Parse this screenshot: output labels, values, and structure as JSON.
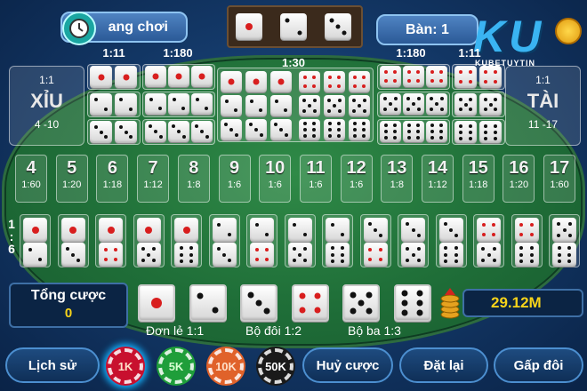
{
  "header": {
    "game_mode_label": "ang chơi",
    "table_label": "Bàn: 1",
    "logo_text": "KU",
    "logo_subtext": "KUBETUYTIN",
    "result_dice": [
      1,
      2,
      3
    ]
  },
  "odds": {
    "any_triple": "1:30",
    "specific_triple_left": "1:180",
    "specific_triple_right": "1:180",
    "double_left": "1:11",
    "double_right": "1:11"
  },
  "small_bet": {
    "ratio": "1:1",
    "label": "XỈU",
    "range": "4 -10"
  },
  "big_bet": {
    "ratio": "1:1",
    "label": "TÀI",
    "range": "11 -17"
  },
  "doubles": [
    1,
    2,
    3,
    4,
    5,
    6
  ],
  "triples": [
    1,
    2,
    3,
    4,
    5,
    6
  ],
  "totals": [
    {
      "sum": "4",
      "odds": "1:60"
    },
    {
      "sum": "5",
      "odds": "1:20"
    },
    {
      "sum": "6",
      "odds": "1:18"
    },
    {
      "sum": "7",
      "odds": "1:12"
    },
    {
      "sum": "8",
      "odds": "1:8"
    },
    {
      "sum": "9",
      "odds": "1:6"
    },
    {
      "sum": "10",
      "odds": "1:6"
    },
    {
      "sum": "11",
      "odds": "1:6"
    },
    {
      "sum": "12",
      "odds": "1:6"
    },
    {
      "sum": "13",
      "odds": "1:8"
    },
    {
      "sum": "14",
      "odds": "1:12"
    },
    {
      "sum": "15",
      "odds": "1:18"
    },
    {
      "sum": "16",
      "odds": "1:20"
    },
    {
      "sum": "17",
      "odds": "1:60"
    }
  ],
  "combos_ratio": "1:6",
  "combos": [
    [
      1,
      2
    ],
    [
      1,
      3
    ],
    [
      1,
      4
    ],
    [
      1,
      5
    ],
    [
      1,
      6
    ],
    [
      2,
      3
    ],
    [
      2,
      4
    ],
    [
      2,
      5
    ],
    [
      2,
      6
    ],
    [
      3,
      4
    ],
    [
      3,
      5
    ],
    [
      3,
      6
    ],
    [
      4,
      5
    ],
    [
      4,
      6
    ],
    [
      5,
      6
    ]
  ],
  "total_bet": {
    "label": "Tổng cược",
    "value": "0"
  },
  "single_dice": [
    1,
    2,
    3,
    4,
    5,
    6
  ],
  "single_labels": {
    "single": "Đơn lẻ 1:1",
    "pair": "Bộ đôi 1:2",
    "triple": "Bộ ba 1:3"
  },
  "balance": "29.12M",
  "chips": [
    {
      "label": "1K",
      "color": "#c8102e"
    },
    {
      "label": "5K",
      "color": "#1f9e3a"
    },
    {
      "label": "10K",
      "color": "#e0622a"
    },
    {
      "label": "50K",
      "color": "#1a1a1a"
    }
  ],
  "buttons": {
    "history": "Lịch sử",
    "cancel_bet": "Huỷ cược",
    "reset": "Đặt lại",
    "double_bet": "Gấp đôi"
  },
  "colors": {
    "felt": "#1f6e38",
    "accent_gold": "#f6d31a",
    "pip_red": "#d81e1e"
  }
}
